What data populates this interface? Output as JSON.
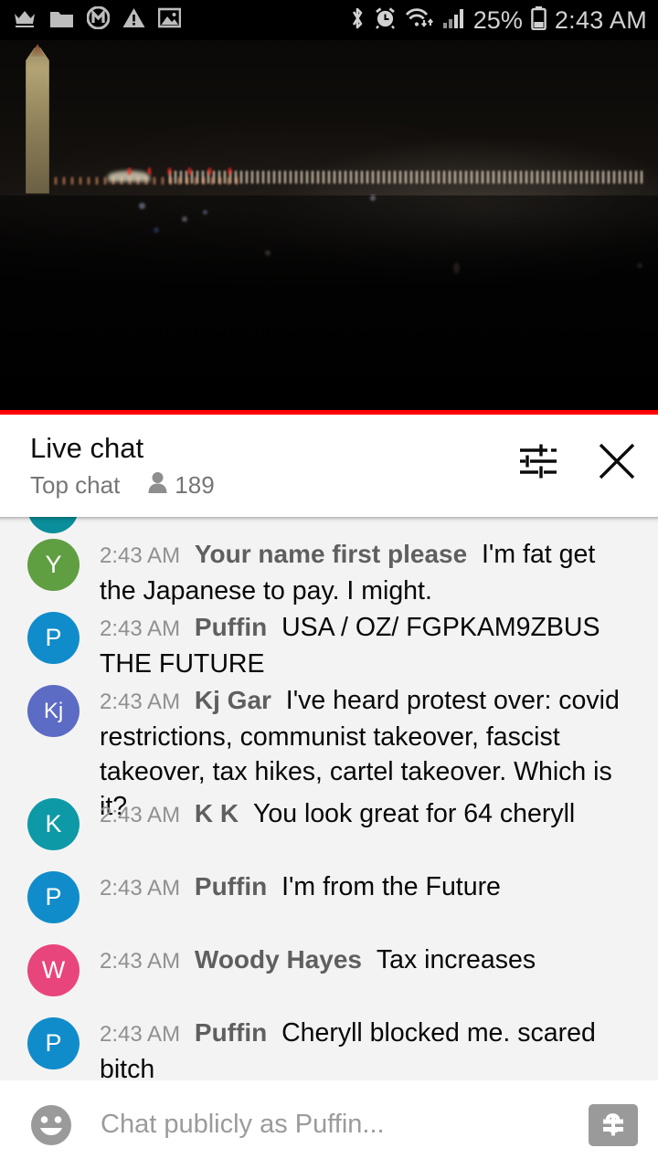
{
  "status_bar": {
    "left_icons": [
      "crown-icon",
      "folder-icon",
      "m-circle-icon",
      "warning-triangle-icon",
      "image-icon"
    ],
    "right_icons": [
      "bluetooth-icon",
      "alarm-clock-icon",
      "wifi-icon",
      "signal-bars-icon",
      "battery-icon"
    ],
    "battery_percent": "25%",
    "clock": "2:43 AM"
  },
  "video": {
    "description": "Night skyline with Washington Monument",
    "progress_color": "#ff0000"
  },
  "chat_header": {
    "title": "Live chat",
    "subtitle": "Top chat",
    "viewer_count": "189",
    "settings_icon": "tune-sliders-icon",
    "close_icon": "close-x-icon"
  },
  "messages": [
    {
      "time": "2:43 AM",
      "author": "Your name first please",
      "text": "I'm fat get the Japanese to pay. I might.",
      "avatar_letter": "Y",
      "avatar_color": "#5f9e41"
    },
    {
      "time": "2:43 AM",
      "author": "Puffin",
      "text": "USA / OZ/ FGPKAM9ZBUS THE FUTURE",
      "avatar_letter": "P",
      "avatar_color": "#108ccb"
    },
    {
      "time": "2:43 AM",
      "author": "Kj Gar",
      "text": "I've heard protest over: covid restrictions, communist takeover, fascist takeover, tax hikes, cartel takeover. Which is it?",
      "avatar_letter": "Kj",
      "avatar_color": "#5c6bc4"
    },
    {
      "time": "2:43 AM",
      "author": "K K",
      "text": "You look great for 64 cheryll",
      "avatar_letter": "K",
      "avatar_color": "#0d9aa6"
    },
    {
      "time": "2:43 AM",
      "author": "Puffin",
      "text": "I'm from the Future",
      "avatar_letter": "P",
      "avatar_color": "#108ccb"
    },
    {
      "time": "2:43 AM",
      "author": "Woody Hayes",
      "text": "Tax increases",
      "avatar_letter": "W",
      "avatar_color": "#e8457c"
    },
    {
      "time": "2:43 AM",
      "author": "Puffin",
      "text": "Cheryll blocked me. scared bitch",
      "avatar_letter": "P",
      "avatar_color": "#108ccb"
    }
  ],
  "input_bar": {
    "emoji_icon": "emoji-smiley-icon",
    "placeholder": "Chat publicly as Puffin...",
    "value": "",
    "superchat_icon": "dollar-bill-icon"
  },
  "colors": {
    "chat_bg": "#f3f3f3",
    "accent_red": "#ff0000"
  }
}
